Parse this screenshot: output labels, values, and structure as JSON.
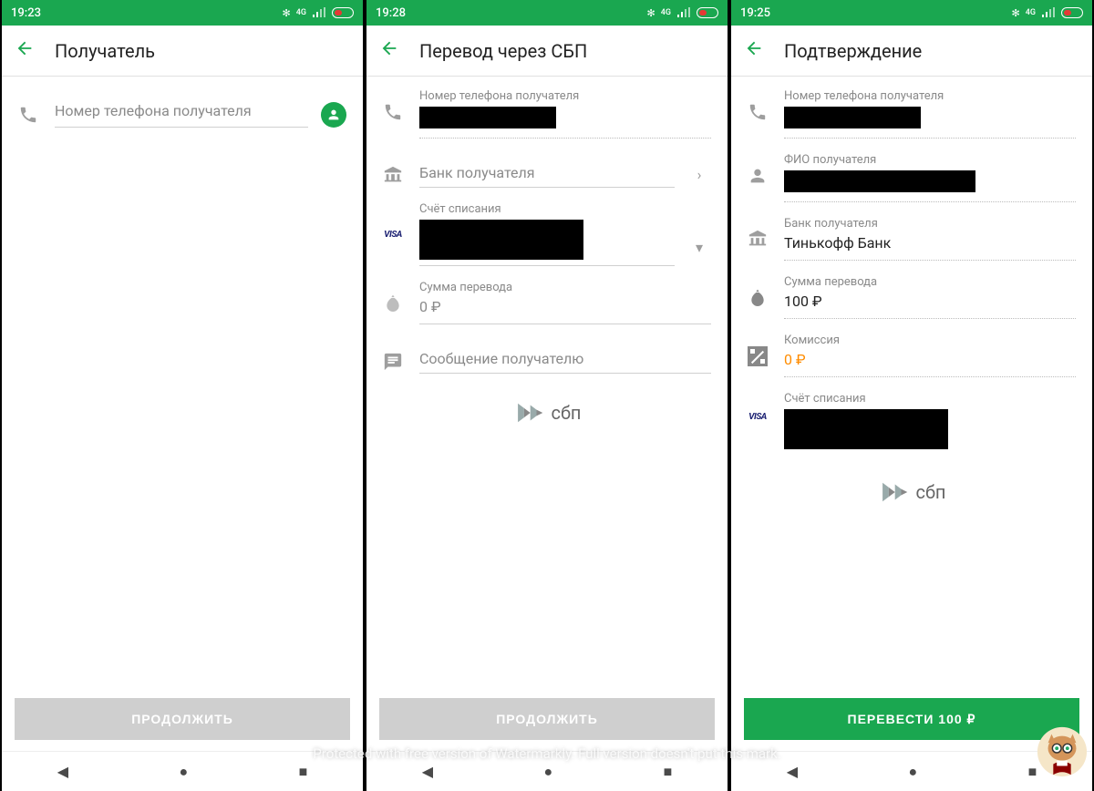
{
  "watermark": "Protected with free version of Watermarkly. Full version doesn't put this mark.",
  "sbp_label": "сбп",
  "nav": {
    "back": "◀",
    "home": "●",
    "recent": "■"
  },
  "status_icons": "✻  4G  ⁴G▮▯▯▯",
  "screens": [
    {
      "time": "19:23",
      "title": "Получатель",
      "button": {
        "label": "ПРОДОЛЖИТЬ",
        "enabled": false
      },
      "phone_placeholder": "Номер телефона получателя"
    },
    {
      "time": "19:28",
      "title": "Перевод через СБП",
      "button": {
        "label": "ПРОДОЛЖИТЬ",
        "enabled": false
      },
      "fields": {
        "phone_label": "Номер телефона получателя",
        "bank_placeholder": "Банк получателя",
        "account_label": "Счёт списания",
        "amount_label": "Сумма перевода",
        "amount_value": "0 ₽",
        "message_placeholder": "Сообщение получателю"
      }
    },
    {
      "time": "19:25",
      "title": "Подтверждение",
      "button": {
        "label": "ПЕРЕВЕСТИ 100 ₽",
        "enabled": true
      },
      "fields": {
        "phone_label": "Номер телефона получателя",
        "name_label": "ФИО получателя",
        "bank_label": "Банк получателя",
        "bank_value": "Тинькофф Банк",
        "amount_label": "Сумма перевода",
        "amount_value": "100 ₽",
        "fee_label": "Комиссия",
        "fee_value": "0 ₽",
        "account_label": "Счёт списания"
      }
    }
  ]
}
